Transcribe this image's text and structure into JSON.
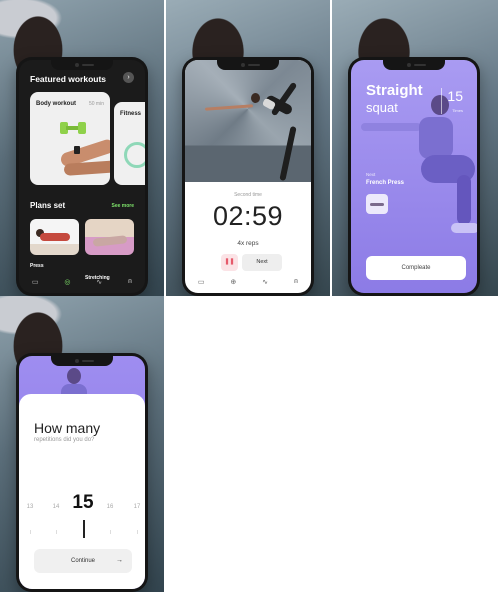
{
  "screen1": {
    "featured_title": "Featured workouts",
    "arrow_icon": "›",
    "card_big_title": "Body workout",
    "card_big_meta": "50 min",
    "card_small_title": "Fitness",
    "plans_title": "Plans set",
    "see_more": "See more",
    "plan_items": [
      "Press",
      "Stretching"
    ],
    "tab_icons": [
      "▭",
      "◎",
      "∿",
      "⍝"
    ],
    "accent_color": "#7ee36a"
  },
  "screen2": {
    "timer_label": "Second time",
    "timer_value": "02:59",
    "reps": "4x reps",
    "pause_icon": "❚❚",
    "next_label": "Next",
    "tab_icons": [
      "▭",
      "⊕",
      "∿",
      "⍝"
    ]
  },
  "screen3": {
    "title_line1": "Straight",
    "title_line2": "squat",
    "count_value": "15",
    "count_unit": "Times",
    "next_label": "Next",
    "next_exercise": "French Press",
    "complete_label": "Compleate",
    "accent_color": "#8c7be6"
  },
  "screen4": {
    "question_line1": "How many",
    "question_line2": "repetitions did you do?",
    "ruler_values": [
      "13",
      "14",
      "15",
      "16",
      "17"
    ],
    "selected_value": "15",
    "continue_label": "Continue",
    "continue_icon": "→"
  }
}
